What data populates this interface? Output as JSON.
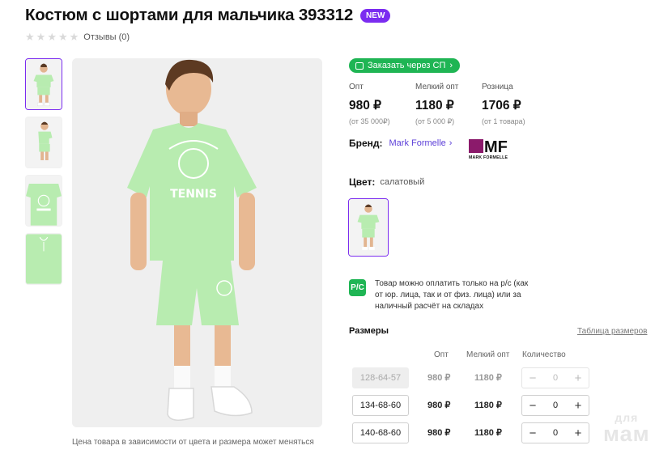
{
  "product": {
    "title": "Костюм с шортами для мальчика 393312",
    "badge": "NEW",
    "reviews": "Отзывы (0)",
    "rating_stars": 0,
    "price_note": "Цена товара в зависимости от цвета и размера может меняться"
  },
  "order_button": {
    "label": "Заказать через СП",
    "icon": "cart-icon"
  },
  "prices": [
    {
      "label": "Опт",
      "value": "980 ₽",
      "sub": "(от 35 000₽)"
    },
    {
      "label": "Мелкий опт",
      "value": "1180 ₽",
      "sub": "(от 5 000 ₽)"
    },
    {
      "label": "Розница",
      "value": "1706 ₽",
      "sub": "(от 1 товара)"
    }
  ],
  "brand": {
    "label": "Бренд:",
    "name": "Mark Formelle",
    "logo_text": "MF",
    "logo_caption": "MARK FORMELLE"
  },
  "color": {
    "label": "Цвет:",
    "value": "салатовый"
  },
  "payment": {
    "icon_text": "P/C",
    "text": "Товар можно оплатить только на р/с (как от юр. лица, так и от физ. лица) или за наличный расчёт на складах"
  },
  "sizes": {
    "title": "Размеры",
    "table_link": "Таблица размеров",
    "columns": {
      "opt": "Опт",
      "small_opt": "Мелкий опт",
      "qty": "Количество"
    },
    "rows": [
      {
        "size": "128-64-57",
        "opt": "980 ₽",
        "small_opt": "1180 ₽",
        "qty": "0",
        "available": false
      },
      {
        "size": "134-68-60",
        "opt": "980 ₽",
        "small_opt": "1180 ₽",
        "qty": "0",
        "available": true
      },
      {
        "size": "140-68-60",
        "opt": "980 ₽",
        "small_opt": "1180 ₽",
        "qty": "0",
        "available": true
      }
    ]
  },
  "watermark": {
    "line1": "для",
    "line2": "мам"
  },
  "colors": {
    "accent": "#7b2cf0",
    "green": "#1fb554",
    "brand_link": "#5c3fd8",
    "mf_logo": "#8b1a6b",
    "garment": "#b8ecb0"
  }
}
